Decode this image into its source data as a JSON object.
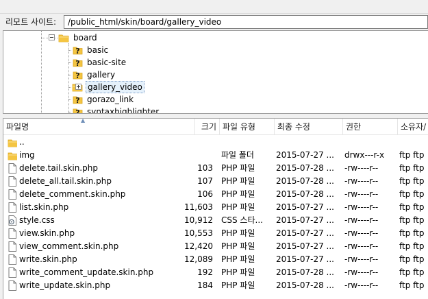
{
  "address_bar": {
    "label": "리모트 사이트:",
    "path": "/public_html/skin/board/gallery_video"
  },
  "tree": {
    "items": [
      {
        "label": "board",
        "icon": "folder-icon",
        "expander": "minus",
        "selected": false
      },
      {
        "label": "basic",
        "icon": "unknown-folder-icon",
        "expander": "",
        "selected": false
      },
      {
        "label": "basic-site",
        "icon": "unknown-folder-icon",
        "expander": "",
        "selected": false
      },
      {
        "label": "gallery",
        "icon": "unknown-folder-icon",
        "expander": "",
        "selected": false
      },
      {
        "label": "gallery_video",
        "icon": "folder-icon",
        "expander": "plus",
        "selected": true
      },
      {
        "label": "gorazo_link",
        "icon": "unknown-folder-icon",
        "expander": "",
        "selected": false
      },
      {
        "label": "syntaxhighlighter",
        "icon": "unknown-folder-icon",
        "expander": "",
        "selected": false
      }
    ]
  },
  "file_list": {
    "columns": {
      "name": "파일명",
      "size": "크기",
      "type": "파일 유형",
      "modified": "최종 수정",
      "permissions": "권한",
      "owner": "소유자/"
    },
    "rows": [
      {
        "icon": "folder-icon",
        "name": "..",
        "size": "",
        "type": "",
        "modified": "",
        "permissions": "",
        "owner": ""
      },
      {
        "icon": "folder-icon",
        "name": "img",
        "size": "",
        "type": "파일 폴더",
        "modified": "2015-07-27 ...",
        "permissions": "drwx---r-x",
        "owner": "ftp ftp"
      },
      {
        "icon": "file-icon",
        "name": "delete.tail.skin.php",
        "size": "103",
        "type": "PHP 파일",
        "modified": "2015-07-28 ...",
        "permissions": "-rw----r--",
        "owner": "ftp ftp"
      },
      {
        "icon": "file-icon",
        "name": "delete_all.tail.skin.php",
        "size": "107",
        "type": "PHP 파일",
        "modified": "2015-07-28 ...",
        "permissions": "-rw----r--",
        "owner": "ftp ftp"
      },
      {
        "icon": "file-icon",
        "name": "delete_comment.skin.php",
        "size": "106",
        "type": "PHP 파일",
        "modified": "2015-07-28 ...",
        "permissions": "-rw----r--",
        "owner": "ftp ftp"
      },
      {
        "icon": "file-icon",
        "name": "list.skin.php",
        "size": "11,603",
        "type": "PHP 파일",
        "modified": "2015-07-27 ...",
        "permissions": "-rw----r--",
        "owner": "ftp ftp"
      },
      {
        "icon": "css-file-icon",
        "name": "style.css",
        "size": "10,912",
        "type": "CSS 스타...",
        "modified": "2015-07-27 ...",
        "permissions": "-rw----r--",
        "owner": "ftp ftp"
      },
      {
        "icon": "file-icon",
        "name": "view.skin.php",
        "size": "10,553",
        "type": "PHP 파일",
        "modified": "2015-07-27 ...",
        "permissions": "-rw----r--",
        "owner": "ftp ftp"
      },
      {
        "icon": "file-icon",
        "name": "view_comment.skin.php",
        "size": "12,420",
        "type": "PHP 파일",
        "modified": "2015-07-27 ...",
        "permissions": "-rw----r--",
        "owner": "ftp ftp"
      },
      {
        "icon": "file-icon",
        "name": "write.skin.php",
        "size": "12,089",
        "type": "PHP 파일",
        "modified": "2015-07-27 ...",
        "permissions": "-rw----r--",
        "owner": "ftp ftp"
      },
      {
        "icon": "file-icon",
        "name": "write_comment_update.skin.php",
        "size": "192",
        "type": "PHP 파일",
        "modified": "2015-07-28 ...",
        "permissions": "-rw----r--",
        "owner": "ftp ftp"
      },
      {
        "icon": "file-icon",
        "name": "write_update.skin.php",
        "size": "184",
        "type": "PHP 파일",
        "modified": "2015-07-28 ...",
        "permissions": "-rw----r--",
        "owner": "ftp ftp"
      }
    ]
  },
  "colors": {
    "folder": "#f4c542",
    "folder_dark": "#d9a520",
    "unknown_mark": "#1a1a1a",
    "selection": "#e5f1fb"
  }
}
